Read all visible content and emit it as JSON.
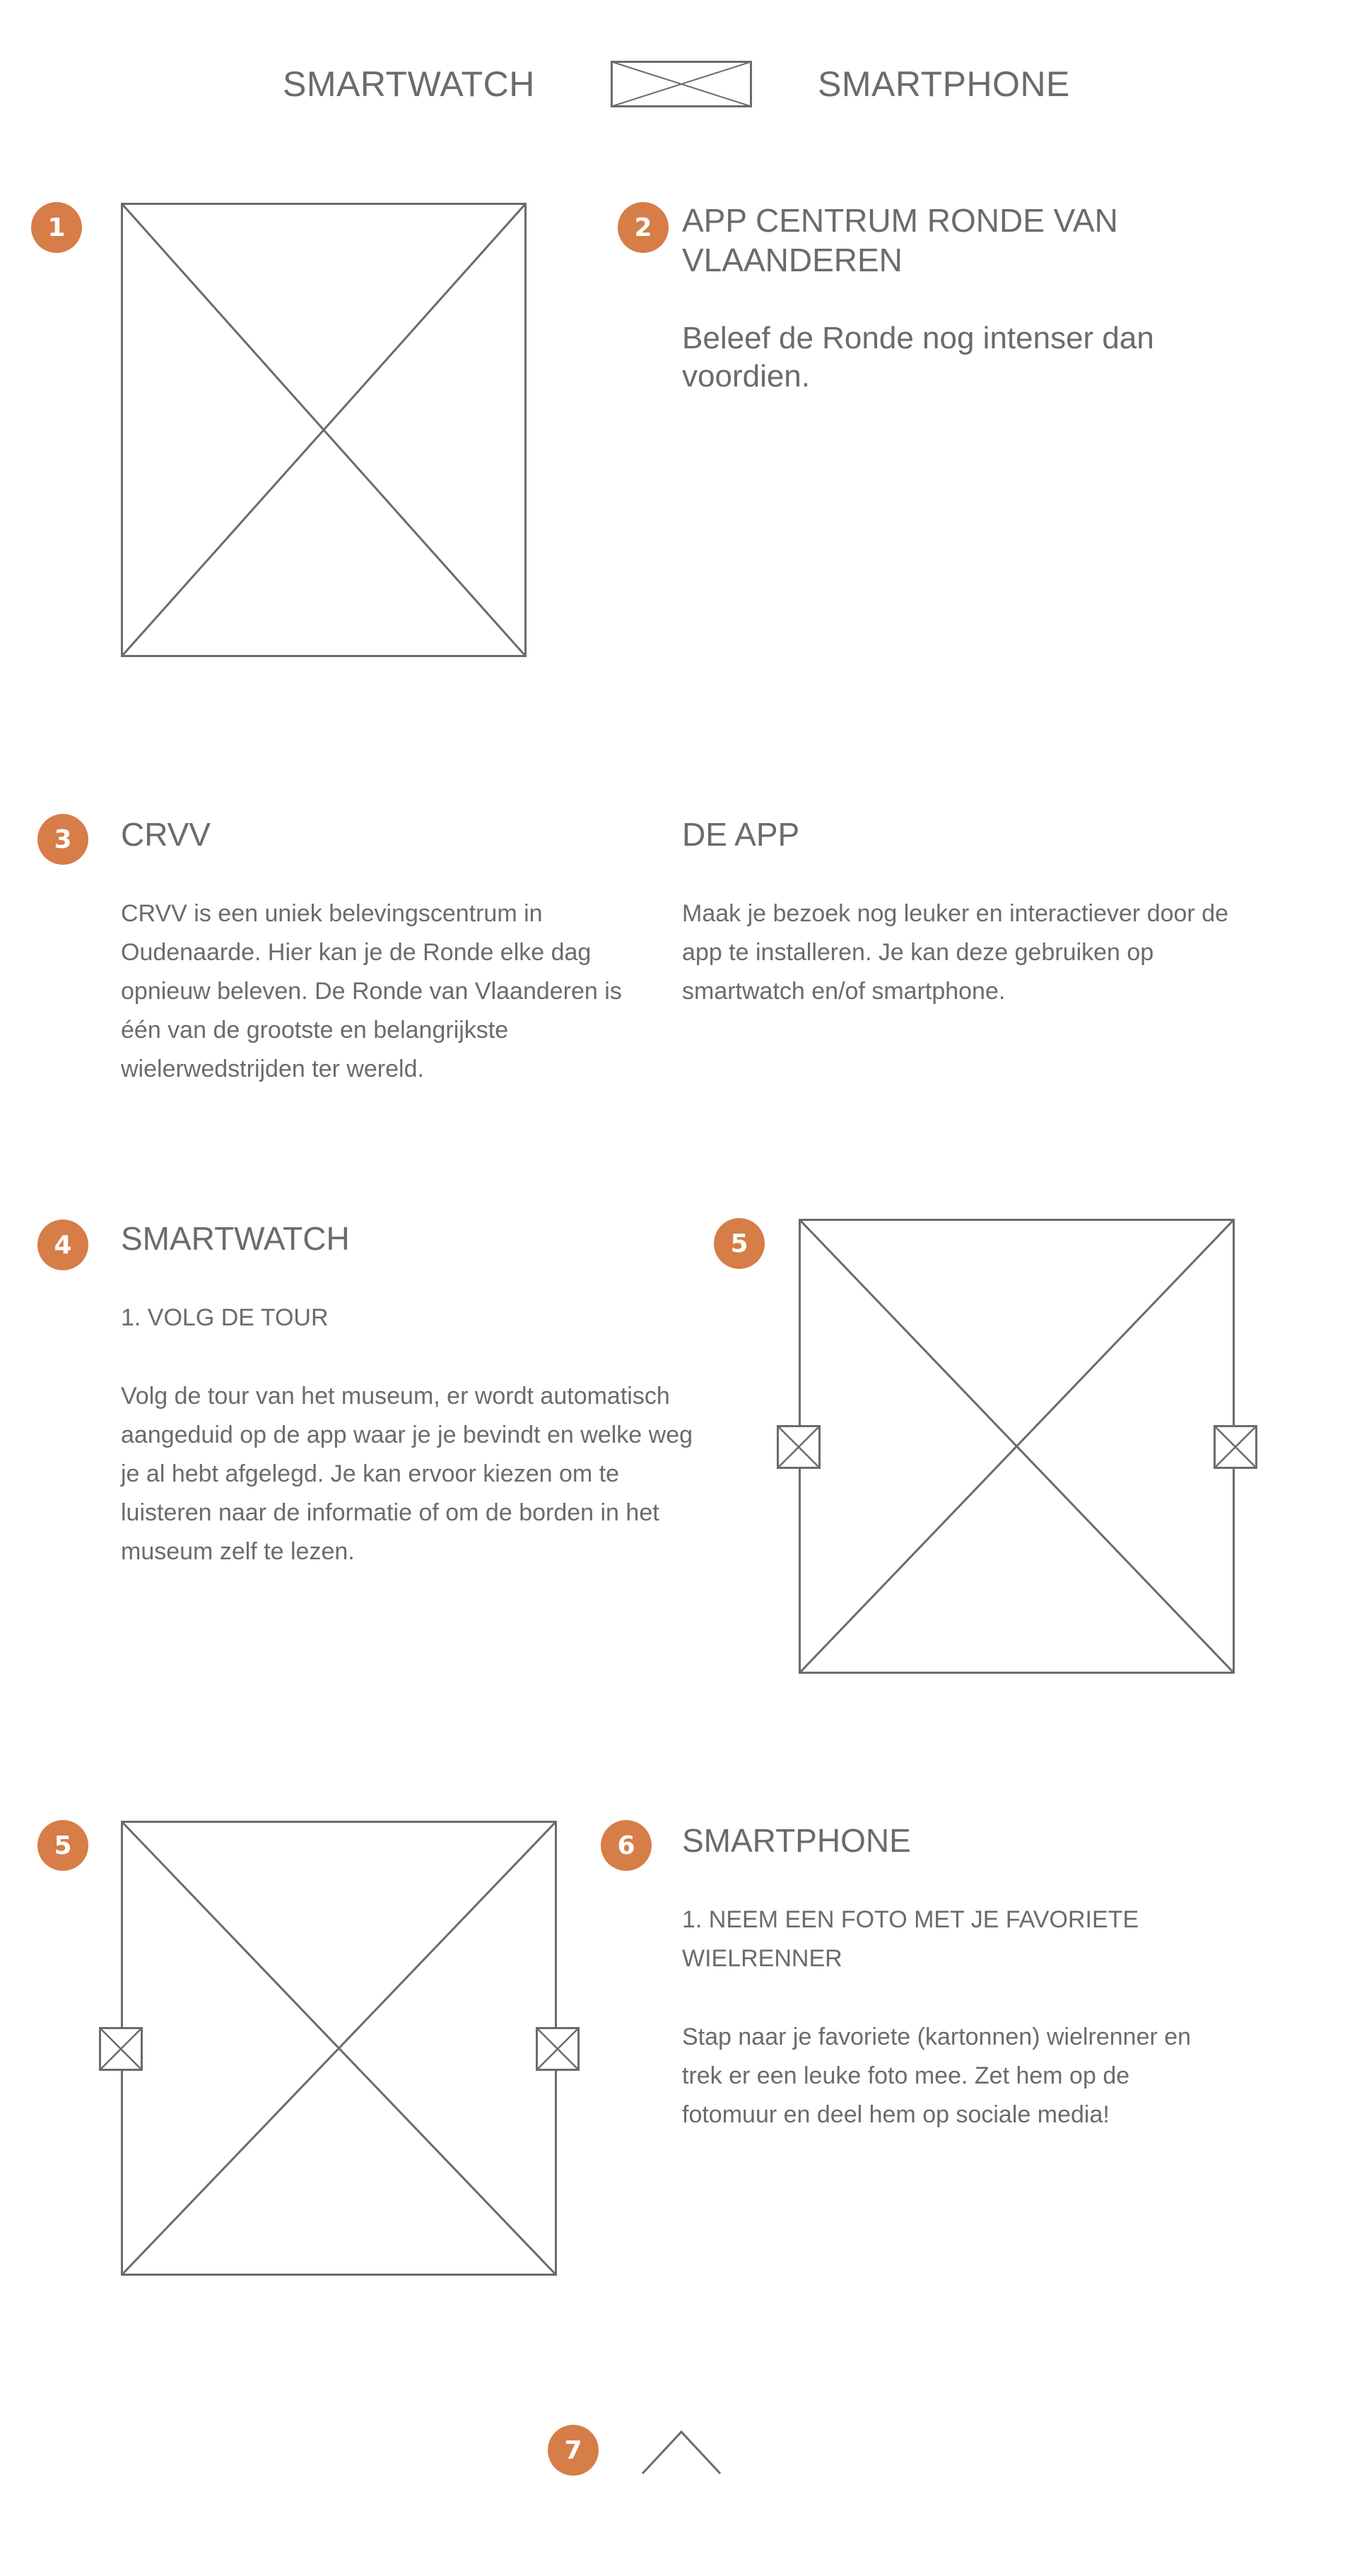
{
  "header": {
    "nav_left": "SMARTWATCH",
    "nav_right": "SMARTPHONE"
  },
  "hero": {
    "badge_image": "1",
    "badge_text": "2",
    "title": "APP CENTRUM RONDE VAN VLAANDEREN",
    "subtitle": "Beleef de Ronde nog intenser dan voordien."
  },
  "intro": {
    "badge": "3",
    "crvv_title": "CRVV",
    "crvv_text": "CRVV is een uniek belevingscentrum in Oudenaarde. Hier kan je de Ronde elke dag opnieuw beleven. De Ronde van Vlaanderen is één van de grootste en belangrijkste wielerwedstrijden ter wereld.",
    "app_title": "DE APP",
    "app_text": "Maak je bezoek nog leuker en interactiever door de app te installeren. Je kan deze gebruiken op smartwatch en/of smartphone."
  },
  "smartwatch": {
    "badge": "4",
    "title": "SMARTWATCH",
    "step": "1. VOLG DE TOUR",
    "text": "Volg de tour van het museum, er wordt automatisch aangeduid op de app waar je je bevindt en welke weg je al hebt afgelegd. Je kan ervoor kiezen om te luisteren naar de informatie of om de borden in het museum zelf te lezen.",
    "carousel_badge": "5"
  },
  "smartphone": {
    "carousel_badge": "5",
    "badge": "6",
    "title": "SMARTPHONE",
    "step": "1. NEEM EEN FOTO MET JE FAVORIETE WIELRENNER",
    "text": "Stap naar je favoriete (kartonnen) wielrenner en trek er een leuke foto mee. Zet hem op de fotomuur en deel hem op sociale media!"
  },
  "footer": {
    "badge": "7",
    "icon": "chevron-up-icon"
  },
  "colors": {
    "accent": "#d67d48",
    "text": "#6b6b6b",
    "wire": "#6b6b6b",
    "background": "#ffffff"
  }
}
